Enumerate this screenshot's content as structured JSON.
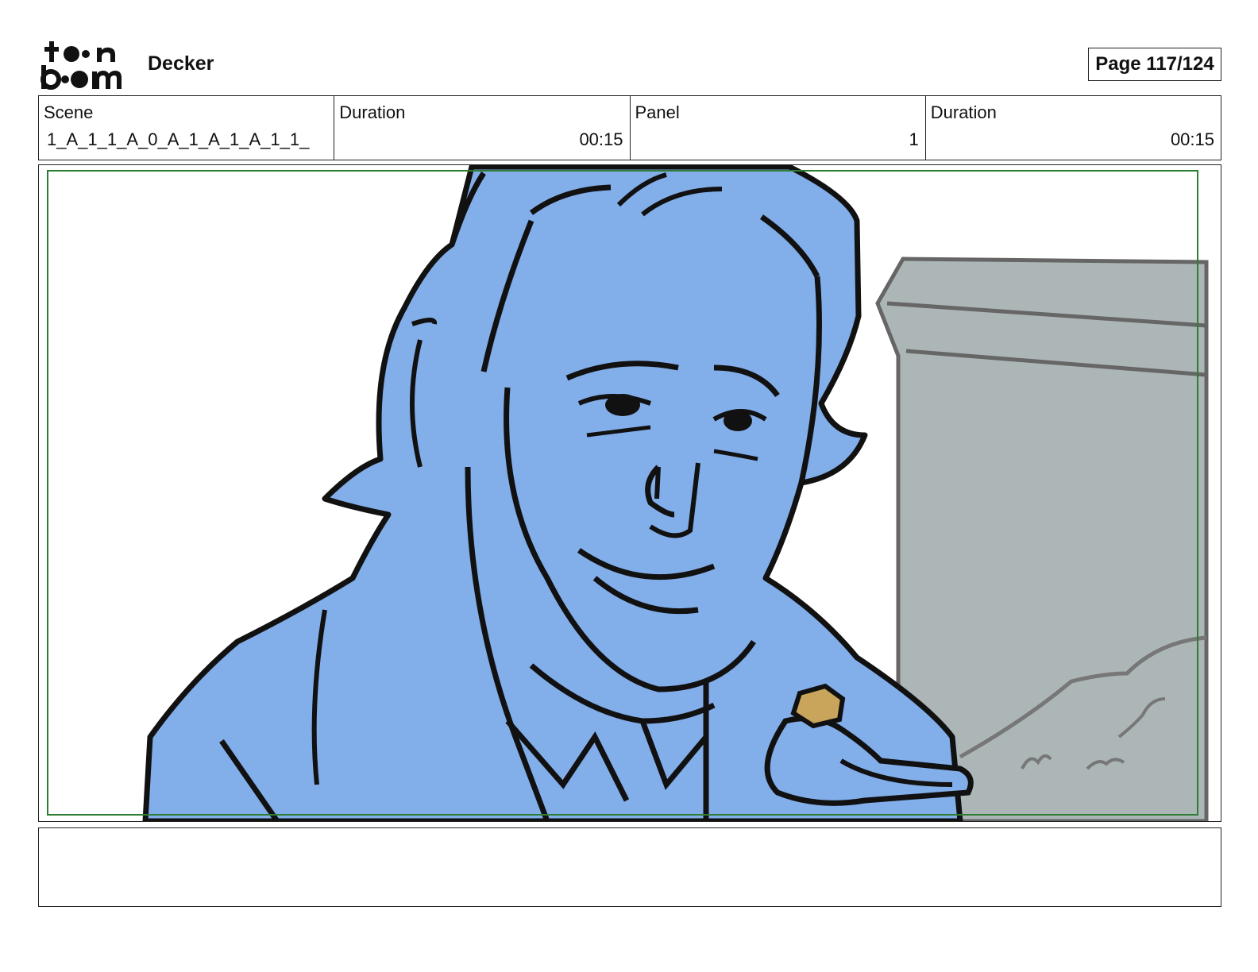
{
  "header": {
    "logo_text": "toon boom",
    "project_title": "Decker",
    "page_label": "Page 117/124"
  },
  "info": {
    "scene_label": "Scene",
    "scene_value": "1_A_1_1_A_0_A_1_A_1_A_1_1_",
    "scene_duration_label": "Duration",
    "scene_duration_value": "00:15",
    "panel_label": "Panel",
    "panel_value": "1",
    "panel_duration_label": "Duration",
    "panel_duration_value": "00:15"
  },
  "panel": {
    "figure_fill": "#82aeea",
    "background_fill": "#adb6b7",
    "coin_fill": "#c8a55a",
    "safe_frame_color": "#2e7d32"
  },
  "notes": {
    "text": ""
  }
}
